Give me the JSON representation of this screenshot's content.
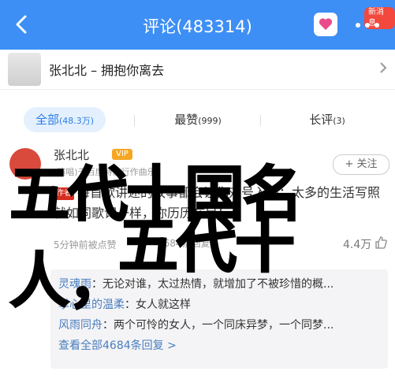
{
  "header": {
    "title": "评论(483314)",
    "badge": "新消息"
  },
  "song": {
    "title": "张北北 – 拥抱你离去"
  },
  "filters": [
    {
      "label": "全部",
      "count": "(48.3万)",
      "active": true
    },
    {
      "label": "最赞",
      "count": "(999)",
      "active": false
    },
    {
      "label": "长评",
      "count": "(3)",
      "active": false
    }
  ],
  "comment": {
    "name": "张北北",
    "vip": "VIP",
    "from": "(演唱)千百度诗流行作曲乐",
    "follow": "+ 关注",
    "tag": "作者",
    "text": "每首歌讲述的故事都会让你对号入座；太多的生活写照就如同歌词一样，你历历在目！",
    "time": "5分钟前被点赞",
    "reply_count": "4684条回复",
    "likes": "4.4万"
  },
  "replies": [
    {
      "name": "灵魂雨",
      "text": "无论对谁，太过热情，就增加了不被珍惜的概..."
    },
    {
      "name": "掌心里的温柔",
      "text": "女人就这样"
    },
    {
      "name": "风雨同舟",
      "text": "两个可怜的女人，一个同床异梦，一个同梦..."
    }
  ],
  "replies_all": "查看全部4684条回复 >",
  "overlay": {
    "line1": "五代十国名人，",
    "line2": "五代十"
  },
  "colors": {
    "header_bg": "#3d8ff5",
    "accent": "#2b7de9",
    "badge": "#f2483d"
  }
}
